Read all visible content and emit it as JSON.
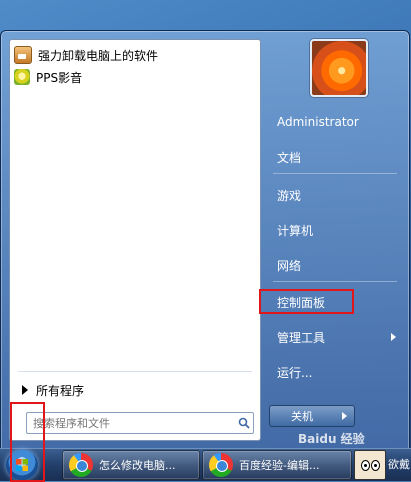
{
  "start_menu": {
    "pinned": [
      {
        "label": "强力卸载电脑上的软件",
        "icon": "uninstall-app-icon"
      },
      {
        "label": "PPS影音",
        "icon": "pps-app-icon"
      }
    ],
    "all_programs_label": "所有程序",
    "search_placeholder": "搜索程序和文件",
    "user_name": "Administrator",
    "right_items": [
      {
        "label": "文档"
      },
      {
        "label": "游戏"
      },
      {
        "label": "计算机"
      },
      {
        "label": "网络"
      },
      {
        "label": "控制面板",
        "highlighted": true
      },
      {
        "label": "管理工具",
        "has_submenu": true
      },
      {
        "label": "运行..."
      }
    ],
    "shutdown_label": "关机"
  },
  "taskbar": {
    "buttons": [
      {
        "label": "怎么修改电脑...",
        "icon": "chrome-like-browser-icon"
      },
      {
        "label": "百度经验-编辑...",
        "icon": "chrome-like-browser-icon"
      }
    ],
    "last_label": "欲戴"
  },
  "watermark": "Baidu 经验",
  "colors": {
    "highlight_red": "#e0161b",
    "accent_blue": "#3e78b8"
  }
}
